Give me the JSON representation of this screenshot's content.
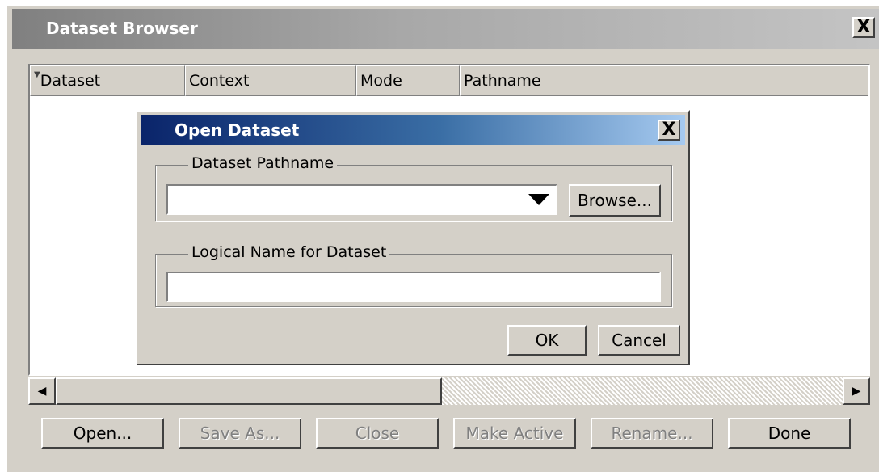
{
  "window": {
    "title": "Dataset Browser",
    "close_glyph": "X"
  },
  "table": {
    "columns": [
      "Dataset",
      "Context",
      "Mode",
      "Pathname"
    ],
    "sort_indicator": "▼",
    "rows": []
  },
  "scrollbar": {
    "left_glyph": "◀",
    "right_glyph": "▶"
  },
  "buttons": {
    "open": "Open...",
    "save_as": "Save As...",
    "close": "Close",
    "make_active": "Make Active",
    "rename": "Rename...",
    "done": "Done"
  },
  "dialog": {
    "title": "Open Dataset",
    "close_glyph": "X",
    "pathname_group_label": "Dataset Pathname",
    "pathname_value": "",
    "browse_label": "Browse...",
    "logical_group_label": "Logical Name for Dataset",
    "logical_value": "",
    "ok_label": "OK",
    "cancel_label": "Cancel"
  },
  "colors": {
    "window_bg": "#d4d0c8",
    "inactive_title_start": "#808080",
    "active_title_start": "#0a246a",
    "active_title_end": "#a6caf0"
  }
}
